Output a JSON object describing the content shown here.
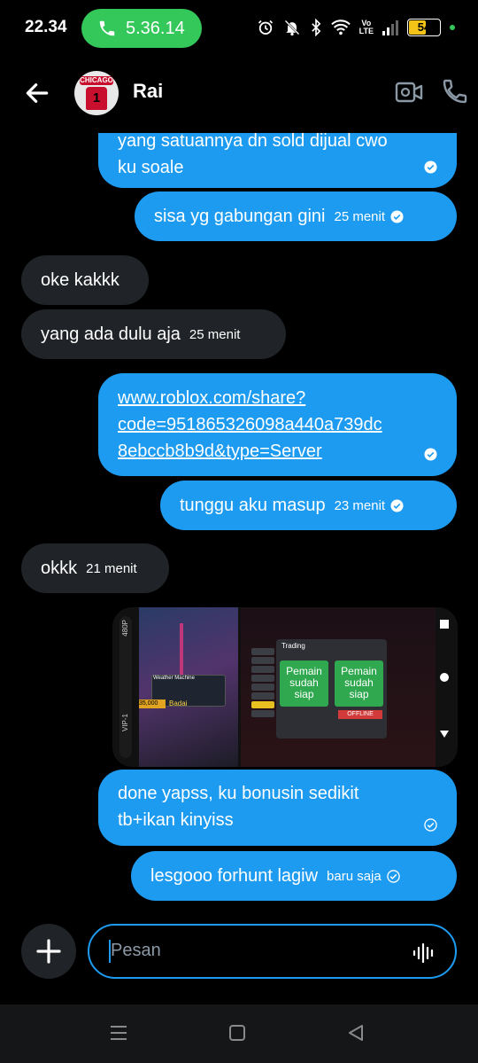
{
  "status_bar": {
    "time": "22.34",
    "call_duration": "5.36.14",
    "battery_level": "54",
    "network_label_top": "Vo",
    "network_label_bottom": "LTE",
    "icons": [
      "alarm-icon",
      "bell-off-icon",
      "bluetooth-icon",
      "wifi-icon",
      "signal-icon",
      "battery-icon"
    ]
  },
  "header": {
    "contact_name": "Rai",
    "avatar_text": "CHICAGO",
    "avatar_number": "1"
  },
  "messages": [
    {
      "direction": "out",
      "text_line1": "yang satuannya dn sold dijual cwo",
      "text_line2": "ku soale",
      "time": ""
    },
    {
      "direction": "out",
      "text": "sisa yg gabungan gini",
      "time": "25 menit"
    },
    {
      "direction": "in",
      "text": "oke kakkk",
      "time": ""
    },
    {
      "direction": "in",
      "text": "yang ada dulu aja",
      "time": "25 menit"
    },
    {
      "direction": "out",
      "link_line1": "www.roblox.com/share?",
      "link_line2": "code=951865326098a440a739dc",
      "link_line3": "8ebccb8b9d&type=Server",
      "time": ""
    },
    {
      "direction": "out",
      "text": "tunggu aku masup",
      "time": "23 menit"
    },
    {
      "direction": "in",
      "text": "okkk",
      "time": "21 menit"
    },
    {
      "direction": "out",
      "type": "image"
    },
    {
      "direction": "out",
      "text_line1": "done yapss, ku bonusin sedikit",
      "text_line2": "tb+ikan kinyiss",
      "time": ""
    },
    {
      "direction": "out",
      "text": "lesgooo forhunt lagiw",
      "time": "baru saja"
    }
  ],
  "media": {
    "label_480p": "480P",
    "label_vip": "VIP-1",
    "trade_title": "Trading",
    "offer_left": "Pemain sudah siap",
    "offer_right": "Pemain sudah siap",
    "weather_label": "Weather Machine",
    "coins": "35,000",
    "badge": "Badai",
    "online": "OFFLINE"
  },
  "composer": {
    "placeholder": "Pesan"
  },
  "colors": {
    "outgoing": "#1d9bf0",
    "incoming": "#202327",
    "call_pill": "#34c759"
  }
}
